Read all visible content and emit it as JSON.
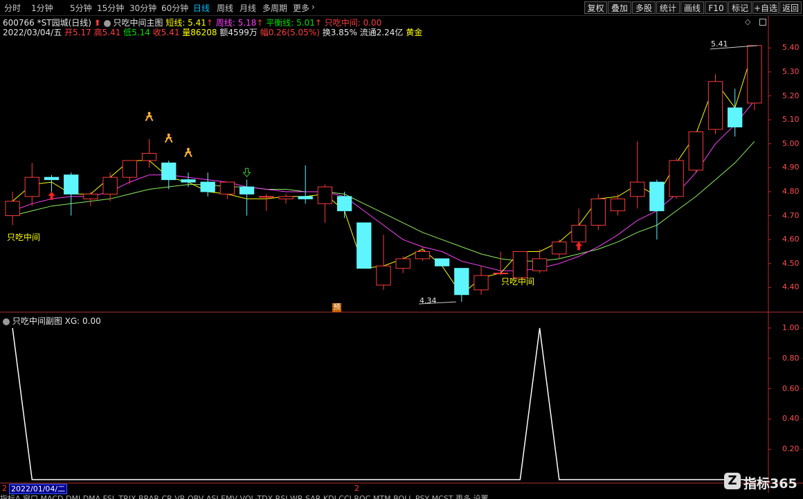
{
  "toolbar": {
    "periods": [
      "分时",
      "1分钟",
      "5分钟",
      "15分钟",
      "30分钟",
      "60分钟",
      "日线",
      "周线",
      "月线",
      "多周期",
      "更多"
    ],
    "active_period": "日线",
    "more_arrow": "›",
    "buttons": [
      "复权",
      "叠加",
      "多股",
      "统计",
      "画线",
      "F10",
      "标记",
      "+自选",
      "返回"
    ]
  },
  "header": {
    "stock": "600766 *ST园城(日线)",
    "indicator_name": "只吃中间主图",
    "short_label": "短线: 5.41",
    "week_label": "周线: 5.18",
    "balance_label": "平衡线: 5.01",
    "signal_label": "只吃中间: 0.00",
    "arrow_up": "↑"
  },
  "quote": {
    "date": "2022/03/04/五",
    "open": "开5.17",
    "high": "高5.41",
    "low": "低5.14",
    "close": "收5.41",
    "volume": "量86208",
    "amount": "额4599万",
    "change": "幅0.26(5.05%)",
    "turnover": "换3.85%",
    "float": "流通2.24亿",
    "tag": "黄金"
  },
  "main_chart": {
    "y_ticks": [
      "5.40",
      "5.30",
      "5.20",
      "5.10",
      "5.00",
      "4.90",
      "4.80",
      "4.70",
      "4.60",
      "4.50",
      "4.40"
    ],
    "label_left": "只吃中间",
    "label_mid": "只吃中间",
    "high_mark": "5.41",
    "low_mark": "4.34",
    "pre_tag": "预",
    "colors": {
      "up": "#ff3c3c",
      "down": "#5ff5ff",
      "short": "#ffff00",
      "week": "#ff40ff",
      "balance": "#90ee60"
    }
  },
  "sub_chart": {
    "title": "只吃中间副图 XG: 0.00",
    "y_ticks": [
      "1.00",
      "0.80",
      "0.60",
      "0.40",
      "0.20"
    ]
  },
  "bottom": {
    "date_box": "2022/01/04/二",
    "left_stub": "2",
    "mid_stub": "2",
    "tabs_text": "指标A 窗口 MACD DMI DMA FSL TRIX BRAR CR VR OBV ASI EMV VOL-TDX RSI WR SAR KDJ CCI ROC MTM BOLL PSY MCST 更多 设置"
  },
  "logo": {
    "text": "指标365",
    "glyph": "Z"
  },
  "chart_data": [
    {
      "type": "candlestick",
      "title": "600766 *ST园城(日线)",
      "ylim": [
        4.3,
        5.45
      ],
      "candles": [
        {
          "o": 4.7,
          "h": 4.8,
          "l": 4.66,
          "c": 4.76
        },
        {
          "o": 4.78,
          "h": 4.92,
          "l": 4.74,
          "c": 4.86
        },
        {
          "o": 4.86,
          "h": 4.87,
          "l": 4.8,
          "c": 4.85
        },
        {
          "o": 4.87,
          "h": 4.88,
          "l": 4.7,
          "c": 4.79
        },
        {
          "o": 4.77,
          "h": 4.8,
          "l": 4.74,
          "c": 4.79
        },
        {
          "o": 4.79,
          "h": 4.88,
          "l": 4.76,
          "c": 4.86
        },
        {
          "o": 4.86,
          "h": 4.93,
          "l": 4.83,
          "c": 4.93
        },
        {
          "o": 4.93,
          "h": 5.02,
          "l": 4.9,
          "c": 4.96
        },
        {
          "o": 4.92,
          "h": 4.93,
          "l": 4.81,
          "c": 4.85
        },
        {
          "o": 4.85,
          "h": 4.88,
          "l": 4.82,
          "c": 4.84
        },
        {
          "o": 4.84,
          "h": 4.88,
          "l": 4.78,
          "c": 4.8
        },
        {
          "o": 4.79,
          "h": 4.84,
          "l": 4.77,
          "c": 4.84
        },
        {
          "o": 4.82,
          "h": 4.85,
          "l": 4.7,
          "c": 4.79
        },
        {
          "o": 4.78,
          "h": 4.79,
          "l": 4.72,
          "c": 4.78
        },
        {
          "o": 4.77,
          "h": 4.79,
          "l": 4.75,
          "c": 4.78
        },
        {
          "o": 4.78,
          "h": 4.91,
          "l": 4.75,
          "c": 4.77
        },
        {
          "o": 4.75,
          "h": 4.83,
          "l": 4.67,
          "c": 4.82
        },
        {
          "o": 4.78,
          "h": 4.8,
          "l": 4.69,
          "c": 4.72
        },
        {
          "o": 4.67,
          "h": 4.67,
          "l": 4.48,
          "c": 4.48
        },
        {
          "o": 4.41,
          "h": 4.62,
          "l": 4.39,
          "c": 4.49
        },
        {
          "o": 4.48,
          "h": 4.53,
          "l": 4.46,
          "c": 4.52
        },
        {
          "o": 4.52,
          "h": 4.57,
          "l": 4.51,
          "c": 4.55
        },
        {
          "o": 4.52,
          "h": 4.52,
          "l": 4.49,
          "c": 4.49
        },
        {
          "o": 4.48,
          "h": 4.48,
          "l": 4.34,
          "c": 4.37
        },
        {
          "o": 4.39,
          "h": 4.49,
          "l": 4.37,
          "c": 4.45
        },
        {
          "o": 4.46,
          "h": 4.55,
          "l": 4.45,
          "c": 4.46
        },
        {
          "o": 4.44,
          "h": 4.55,
          "l": 4.44,
          "c": 4.55
        },
        {
          "o": 4.47,
          "h": 4.56,
          "l": 4.46,
          "c": 4.52
        },
        {
          "o": 4.54,
          "h": 4.6,
          "l": 4.52,
          "c": 4.59
        },
        {
          "o": 4.59,
          "h": 4.73,
          "l": 4.57,
          "c": 4.66
        },
        {
          "o": 4.66,
          "h": 4.79,
          "l": 4.64,
          "c": 4.77
        },
        {
          "o": 4.72,
          "h": 4.79,
          "l": 4.7,
          "c": 4.77
        },
        {
          "o": 4.78,
          "h": 5.01,
          "l": 4.73,
          "c": 4.84
        },
        {
          "o": 4.84,
          "h": 4.85,
          "l": 4.6,
          "c": 4.72
        },
        {
          "o": 4.78,
          "h": 4.94,
          "l": 4.77,
          "c": 4.93
        },
        {
          "o": 4.89,
          "h": 5.05,
          "l": 4.88,
          "c": 5.05
        },
        {
          "o": 5.06,
          "h": 5.29,
          "l": 5.04,
          "c": 5.26
        },
        {
          "o": 5.15,
          "h": 5.23,
          "l": 5.03,
          "c": 5.07
        },
        {
          "o": 5.17,
          "h": 5.41,
          "l": 5.14,
          "c": 5.41
        }
      ],
      "short_line": [
        4.76,
        4.83,
        4.84,
        4.79,
        4.79,
        4.86,
        4.93,
        4.93,
        4.86,
        4.84,
        4.8,
        4.79,
        4.77,
        4.77,
        4.78,
        4.78,
        4.79,
        4.72,
        4.48,
        4.49,
        4.52,
        4.56,
        4.49,
        4.37,
        4.44,
        4.46,
        4.55,
        4.55,
        4.59,
        4.66,
        4.77,
        4.78,
        4.83,
        4.78,
        4.92,
        5.04,
        5.26,
        5.15,
        5.41
      ],
      "week_line": [
        4.72,
        4.75,
        4.77,
        4.78,
        4.78,
        4.8,
        4.84,
        4.87,
        4.87,
        4.86,
        4.85,
        4.84,
        4.82,
        4.81,
        4.8,
        4.8,
        4.8,
        4.78,
        4.72,
        4.66,
        4.6,
        4.57,
        4.55,
        4.51,
        4.49,
        4.47,
        4.47,
        4.48,
        4.5,
        4.53,
        4.57,
        4.62,
        4.68,
        4.72,
        4.79,
        4.88,
        5.0,
        5.08,
        5.18
      ],
      "balance_line": [
        4.7,
        4.72,
        4.74,
        4.75,
        4.76,
        4.77,
        4.79,
        4.81,
        4.82,
        4.83,
        4.83,
        4.82,
        4.82,
        4.81,
        4.81,
        4.8,
        4.8,
        4.79,
        4.75,
        4.71,
        4.67,
        4.63,
        4.6,
        4.57,
        4.54,
        4.52,
        4.51,
        4.51,
        4.52,
        4.54,
        4.56,
        4.59,
        4.63,
        4.66,
        4.72,
        4.78,
        4.85,
        4.92,
        5.01
      ]
    },
    {
      "type": "line",
      "title": "只吃中间副图 XG: 0.00",
      "ylim": [
        0,
        1
      ],
      "values": [
        1,
        0,
        0,
        0,
        0,
        0,
        0,
        0,
        0,
        0,
        0,
        0,
        0,
        0,
        0,
        0,
        0,
        0,
        0,
        0,
        0,
        0,
        0,
        0,
        0,
        0,
        0,
        1,
        0,
        0,
        0,
        0,
        0,
        0,
        0,
        0,
        0,
        0,
        0
      ]
    }
  ]
}
